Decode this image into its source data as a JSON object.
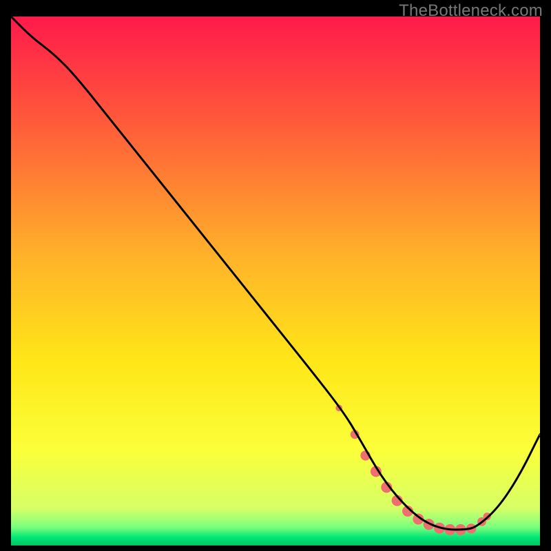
{
  "watermark": "TheBottleneck.com",
  "chart_data": {
    "type": "line",
    "title": "",
    "xlabel": "",
    "ylabel": "",
    "xlim": [
      0,
      100
    ],
    "ylim": [
      0,
      100
    ],
    "grid": false,
    "legend": false,
    "gradient_stops": [
      {
        "offset": 0.0,
        "color": "#ff1a4b"
      },
      {
        "offset": 0.2,
        "color": "#ff5a3a"
      },
      {
        "offset": 0.45,
        "color": "#ffb12a"
      },
      {
        "offset": 0.65,
        "color": "#ffe617"
      },
      {
        "offset": 0.82,
        "color": "#fbff3a"
      },
      {
        "offset": 0.93,
        "color": "#d6ff66"
      },
      {
        "offset": 0.965,
        "color": "#7dff7d"
      },
      {
        "offset": 0.985,
        "color": "#00e676"
      },
      {
        "offset": 1.0,
        "color": "#00c465"
      }
    ],
    "series": [
      {
        "name": "bottleneck-curve",
        "x": [
          0,
          4,
          8,
          12,
          20,
          30,
          40,
          50,
          58,
          63,
          66,
          70,
          74,
          78,
          82,
          86,
          88,
          92,
          96,
          100
        ],
        "y": [
          100,
          96,
          93,
          89,
          79,
          66.5,
          54,
          41.5,
          31.5,
          25,
          20,
          13,
          8,
          4.5,
          3,
          3,
          3.5,
          7,
          13,
          21
        ]
      }
    ],
    "markers": {
      "name": "highlight-dots",
      "x": [
        62,
        65,
        67,
        69,
        71,
        73,
        75,
        77,
        79,
        81,
        83,
        85,
        87,
        89,
        90
      ],
      "y": [
        26,
        21,
        17,
        14,
        11,
        8.5,
        6.5,
        5,
        4,
        3.3,
        3,
        3,
        3.2,
        4.5,
        5.5
      ],
      "r": [
        3,
        4,
        4.5,
        5,
        5,
        5,
        5,
        5,
        5,
        5,
        5,
        5,
        4.5,
        4,
        3.5
      ],
      "color": "#ef6e6e"
    }
  }
}
